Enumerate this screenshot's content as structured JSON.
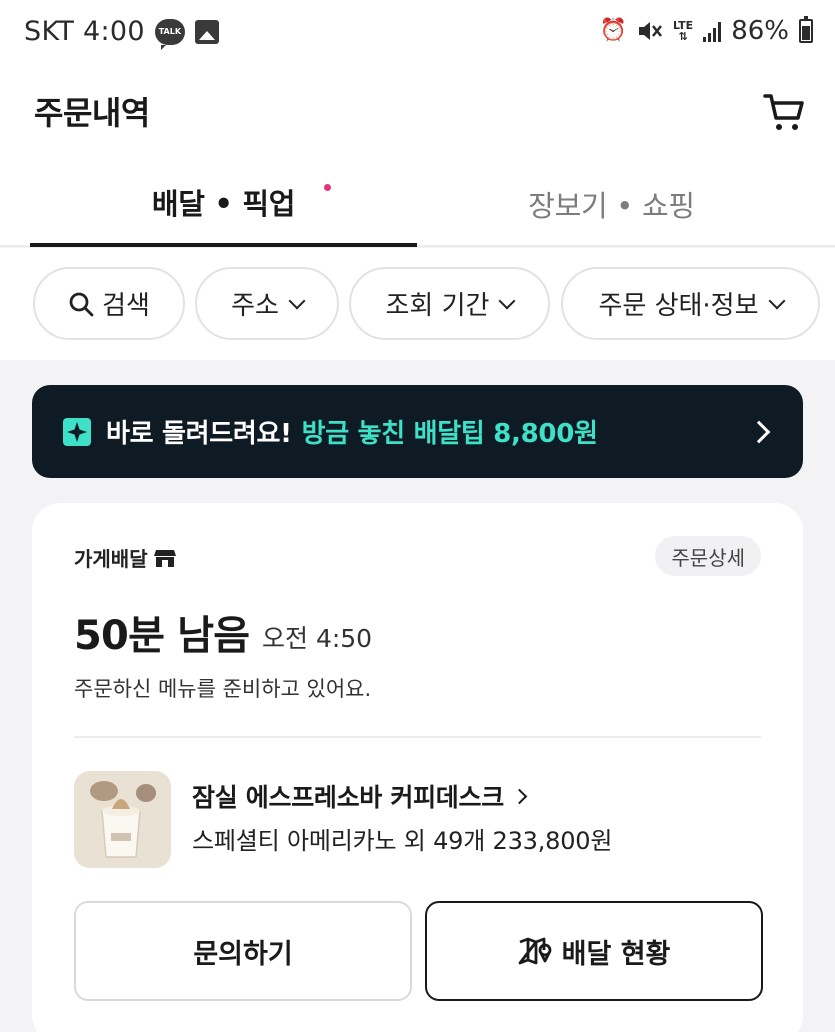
{
  "status_bar": {
    "carrier_time": "SKT 4:00",
    "talk_badge": "TALK",
    "network": "LTE",
    "battery": "86%"
  },
  "header": {
    "title": "주문내역"
  },
  "tabs": [
    {
      "label": "배달 • 픽업",
      "active": true,
      "has_dot": true
    },
    {
      "label": "장보기 • 쇼핑",
      "active": false
    }
  ],
  "filters": {
    "search": "검색",
    "address": "주소",
    "period": "조회 기간",
    "status": "주문 상태·정보"
  },
  "banner": {
    "text": "바로 돌려드려요!",
    "highlight": "방금 놓친 배달팁 8,800원"
  },
  "order": {
    "delivery_type": "가게배달",
    "detail_label": "주문상세",
    "time_left": "50분 남음",
    "eta": "오전 4:50",
    "status_message": "주문하신 메뉴를 준비하고 있어요.",
    "store_name": "잠실 에스프레소바 커피데스크",
    "summary": "스페셜티 아메리카노 외 49개 233,800원",
    "inquiry_label": "문의하기",
    "tracking_label": "배달 현황"
  },
  "colors": {
    "banner_bg": "#0e1a24",
    "banner_highlight": "#3ee0c8",
    "tab_dot": "#e6337a"
  }
}
